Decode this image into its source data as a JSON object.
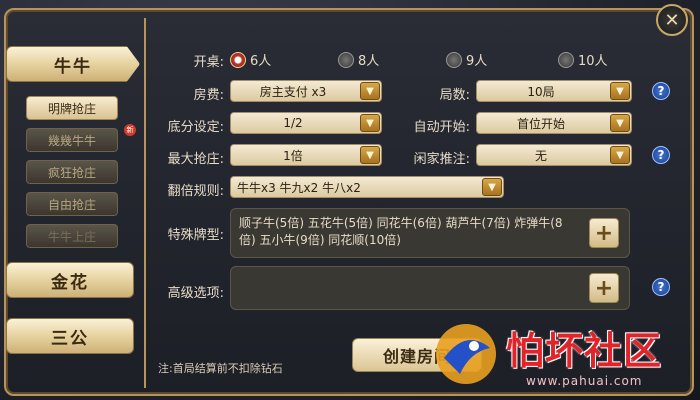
{
  "sidebar": {
    "categories": [
      {
        "label": "牛牛"
      },
      {
        "label": "金花"
      },
      {
        "label": "三公"
      }
    ],
    "sub_options": [
      {
        "label": "明牌抢庄"
      },
      {
        "label": "幾幾牛牛"
      },
      {
        "label": "疯狂抢庄"
      },
      {
        "label": "自由抢庄"
      },
      {
        "label": "牛牛上庄"
      }
    ],
    "new_badge": "新"
  },
  "form": {
    "table_label": "开桌:",
    "players": [
      {
        "label": "6人",
        "selected": true
      },
      {
        "label": "8人",
        "selected": false
      },
      {
        "label": "9人",
        "selected": false
      },
      {
        "label": "10人",
        "selected": false
      }
    ],
    "room_fee_label": "房费:",
    "room_fee_value": "房主支付 x3",
    "rounds_label": "局数:",
    "rounds_value": "10局",
    "base_score_label": "底分设定:",
    "base_score_value": "1/2",
    "auto_start_label": "自动开始:",
    "auto_start_value": "首位开始",
    "max_grab_label": "最大抢庄:",
    "max_grab_value": "1倍",
    "idle_push_label": "闲家推注:",
    "idle_push_value": "无",
    "multiplier_label": "翻倍规则:",
    "multiplier_value": "牛牛x3  牛九x2  牛八x2",
    "special_label": "特殊牌型:",
    "special_value": "顺子牛(5倍) 五花牛(5倍) 同花牛(6倍) 葫芦牛(7倍) 炸弹牛(8倍) 五小牛(9倍) 同花顺(10倍)",
    "advanced_label": "高级选项:",
    "advanced_value": ""
  },
  "footer": {
    "note": "注:首局结算前不扣除钻石",
    "create_label": "创建房间"
  },
  "close_symbol": "✕",
  "help_symbol": "?",
  "plus_symbol": "+",
  "watermark": {
    "title": "怕坏社区",
    "url": "www.pahuai.com"
  },
  "colors": {
    "gold_border": "#b9945a",
    "radio_selected": "#c0392b",
    "help_blue": "#2f5fc4",
    "watermark_red": "#e0242a"
  }
}
